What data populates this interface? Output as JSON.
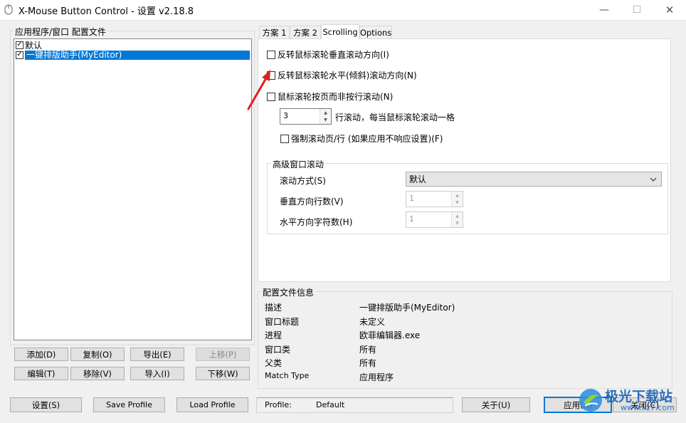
{
  "window": {
    "title": "X-Mouse Button Control - 设置 v2.18.8",
    "minimize_glyph": "—",
    "maximize_glyph": "☐",
    "close_glyph": "✕"
  },
  "profiles": {
    "group_label": "应用程序/窗口 配置文件",
    "items": [
      {
        "label": "默认",
        "checked": true,
        "selected": false
      },
      {
        "label": "一键排版助手(MyEditor)",
        "checked": true,
        "selected": true
      }
    ],
    "buttons": {
      "add": "添加(D)",
      "copy": "复制(O)",
      "export": "导出(E)",
      "move_up": "上移(P)",
      "edit": "编辑(T)",
      "remove": "移除(V)",
      "import": "导入(I)",
      "move_down": "下移(W)"
    }
  },
  "tabs": [
    {
      "label": "方案 1",
      "active": false
    },
    {
      "label": "方案 2",
      "active": false
    },
    {
      "label": "Scrolling",
      "active": true
    },
    {
      "label": "Options",
      "active": false
    }
  ],
  "scrolling": {
    "invert_vertical": "反转鼠标滚轮垂直滚动方向(I)",
    "invert_horizontal": "反转鼠标滚轮水平(倾斜)滚动方向(N)",
    "scroll_by_page": "鼠标滚轮按页而非按行滚动(N)",
    "lines_value": "3",
    "lines_suffix": "行滚动，每当鼠标滚轮滚动一格",
    "force_scroll": "强制滚动页/行 (如果应用不响应设置)(F)",
    "advanced": {
      "group_label": "高级窗口滚动",
      "mode_label": "滚动方式(S)",
      "mode_value": "默认",
      "vertical_label": "垂直方向行数(V)",
      "vertical_value": "1",
      "horizontal_label": "水平方向字符数(H)",
      "horizontal_value": "1"
    }
  },
  "profile_info": {
    "group_label": "配置文件信息",
    "rows": [
      {
        "label": "描述",
        "value": "一键排版助手(MyEditor)"
      },
      {
        "label": "窗口标题",
        "value": "未定义"
      },
      {
        "label": "进程",
        "value": "欧菲编辑器.exe"
      },
      {
        "label": "窗口类",
        "value": "所有"
      },
      {
        "label": "父类",
        "value": "所有"
      },
      {
        "label": "Match Type",
        "value": "应用程序"
      }
    ]
  },
  "bottom_bar": {
    "settings": "设置(S)",
    "save_profile": "Save Profile",
    "load_profile": "Load Profile",
    "profile_label": "Profile:",
    "profile_value": "Default",
    "about": "关于(U)",
    "apply": "应用(A)",
    "close": "关闭(C)"
  },
  "watermark": {
    "text": "极光下载站",
    "url": "www.xz7.com"
  },
  "colors": {
    "selection": "#0078d7",
    "annotation_arrow": "#e02020"
  }
}
